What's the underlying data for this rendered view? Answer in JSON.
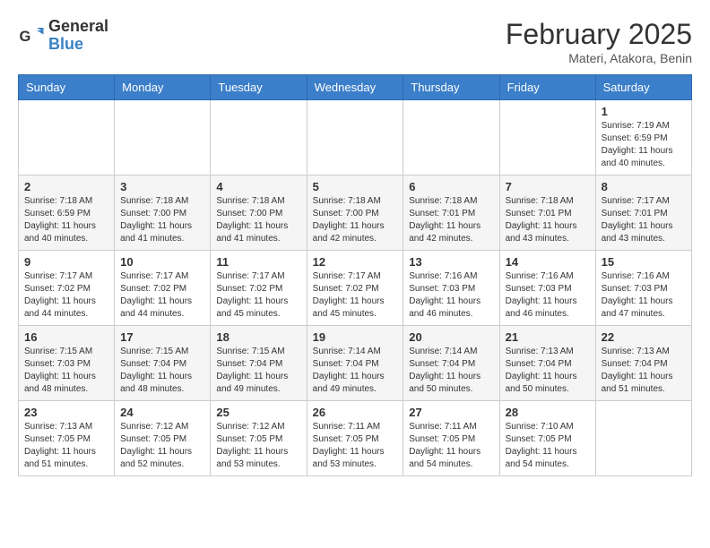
{
  "header": {
    "logo": {
      "general": "General",
      "blue": "Blue"
    },
    "month": "February 2025",
    "location": "Materi, Atakora, Benin"
  },
  "weekdays": [
    "Sunday",
    "Monday",
    "Tuesday",
    "Wednesday",
    "Thursday",
    "Friday",
    "Saturday"
  ],
  "weeks": [
    [
      {
        "day": "",
        "info": ""
      },
      {
        "day": "",
        "info": ""
      },
      {
        "day": "",
        "info": ""
      },
      {
        "day": "",
        "info": ""
      },
      {
        "day": "",
        "info": ""
      },
      {
        "day": "",
        "info": ""
      },
      {
        "day": "1",
        "info": "Sunrise: 7:19 AM\nSunset: 6:59 PM\nDaylight: 11 hours\nand 40 minutes."
      }
    ],
    [
      {
        "day": "2",
        "info": "Sunrise: 7:18 AM\nSunset: 6:59 PM\nDaylight: 11 hours\nand 40 minutes."
      },
      {
        "day": "3",
        "info": "Sunrise: 7:18 AM\nSunset: 7:00 PM\nDaylight: 11 hours\nand 41 minutes."
      },
      {
        "day": "4",
        "info": "Sunrise: 7:18 AM\nSunset: 7:00 PM\nDaylight: 11 hours\nand 41 minutes."
      },
      {
        "day": "5",
        "info": "Sunrise: 7:18 AM\nSunset: 7:00 PM\nDaylight: 11 hours\nand 42 minutes."
      },
      {
        "day": "6",
        "info": "Sunrise: 7:18 AM\nSunset: 7:01 PM\nDaylight: 11 hours\nand 42 minutes."
      },
      {
        "day": "7",
        "info": "Sunrise: 7:18 AM\nSunset: 7:01 PM\nDaylight: 11 hours\nand 43 minutes."
      },
      {
        "day": "8",
        "info": "Sunrise: 7:17 AM\nSunset: 7:01 PM\nDaylight: 11 hours\nand 43 minutes."
      }
    ],
    [
      {
        "day": "9",
        "info": "Sunrise: 7:17 AM\nSunset: 7:02 PM\nDaylight: 11 hours\nand 44 minutes."
      },
      {
        "day": "10",
        "info": "Sunrise: 7:17 AM\nSunset: 7:02 PM\nDaylight: 11 hours\nand 44 minutes."
      },
      {
        "day": "11",
        "info": "Sunrise: 7:17 AM\nSunset: 7:02 PM\nDaylight: 11 hours\nand 45 minutes."
      },
      {
        "day": "12",
        "info": "Sunrise: 7:17 AM\nSunset: 7:02 PM\nDaylight: 11 hours\nand 45 minutes."
      },
      {
        "day": "13",
        "info": "Sunrise: 7:16 AM\nSunset: 7:03 PM\nDaylight: 11 hours\nand 46 minutes."
      },
      {
        "day": "14",
        "info": "Sunrise: 7:16 AM\nSunset: 7:03 PM\nDaylight: 11 hours\nand 46 minutes."
      },
      {
        "day": "15",
        "info": "Sunrise: 7:16 AM\nSunset: 7:03 PM\nDaylight: 11 hours\nand 47 minutes."
      }
    ],
    [
      {
        "day": "16",
        "info": "Sunrise: 7:15 AM\nSunset: 7:03 PM\nDaylight: 11 hours\nand 48 minutes."
      },
      {
        "day": "17",
        "info": "Sunrise: 7:15 AM\nSunset: 7:04 PM\nDaylight: 11 hours\nand 48 minutes."
      },
      {
        "day": "18",
        "info": "Sunrise: 7:15 AM\nSunset: 7:04 PM\nDaylight: 11 hours\nand 49 minutes."
      },
      {
        "day": "19",
        "info": "Sunrise: 7:14 AM\nSunset: 7:04 PM\nDaylight: 11 hours\nand 49 minutes."
      },
      {
        "day": "20",
        "info": "Sunrise: 7:14 AM\nSunset: 7:04 PM\nDaylight: 11 hours\nand 50 minutes."
      },
      {
        "day": "21",
        "info": "Sunrise: 7:13 AM\nSunset: 7:04 PM\nDaylight: 11 hours\nand 50 minutes."
      },
      {
        "day": "22",
        "info": "Sunrise: 7:13 AM\nSunset: 7:04 PM\nDaylight: 11 hours\nand 51 minutes."
      }
    ],
    [
      {
        "day": "23",
        "info": "Sunrise: 7:13 AM\nSunset: 7:05 PM\nDaylight: 11 hours\nand 51 minutes."
      },
      {
        "day": "24",
        "info": "Sunrise: 7:12 AM\nSunset: 7:05 PM\nDaylight: 11 hours\nand 52 minutes."
      },
      {
        "day": "25",
        "info": "Sunrise: 7:12 AM\nSunset: 7:05 PM\nDaylight: 11 hours\nand 53 minutes."
      },
      {
        "day": "26",
        "info": "Sunrise: 7:11 AM\nSunset: 7:05 PM\nDaylight: 11 hours\nand 53 minutes."
      },
      {
        "day": "27",
        "info": "Sunrise: 7:11 AM\nSunset: 7:05 PM\nDaylight: 11 hours\nand 54 minutes."
      },
      {
        "day": "28",
        "info": "Sunrise: 7:10 AM\nSunset: 7:05 PM\nDaylight: 11 hours\nand 54 minutes."
      },
      {
        "day": "",
        "info": ""
      }
    ]
  ]
}
